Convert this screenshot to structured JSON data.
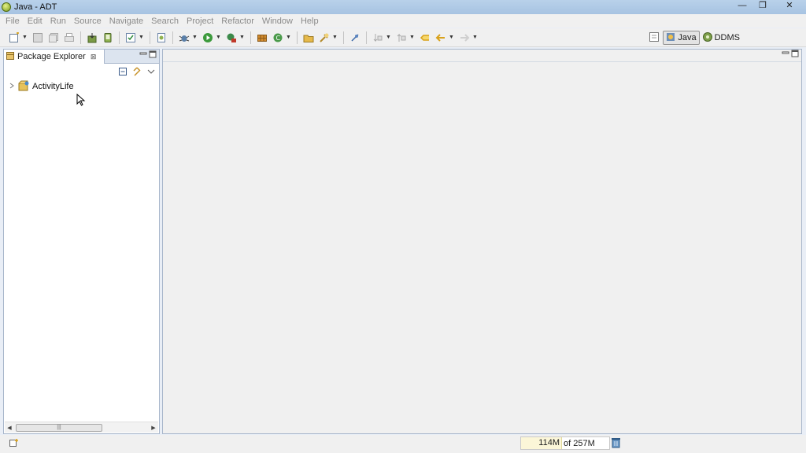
{
  "window": {
    "title": "Java - ADT",
    "controls": {
      "minimize": "—",
      "restore": "❐",
      "close": "✕"
    }
  },
  "menu": [
    "File",
    "Edit",
    "Run",
    "Source",
    "Navigate",
    "Search",
    "Project",
    "Refactor",
    "Window",
    "Help"
  ],
  "toolbar": {
    "icons": [
      "new-icon",
      "save-icon",
      "save-all-icon",
      "print-icon",
      "open-type-icon",
      "sdk-manager-icon",
      "checkbox-icon",
      "android-wizard-icon",
      "debug-icon",
      "run-icon",
      "external-tools-icon",
      "build-icon",
      "refresh-icon",
      "open-folder-icon",
      "search-flashlight-icon",
      "pin-icon",
      "next-annotation-icon",
      "prev-annotation-icon",
      "last-edit-icon",
      "back-icon",
      "forward-icon"
    ]
  },
  "perspectives": {
    "java_label": "Java",
    "ddms_label": "DDMS"
  },
  "package_explorer": {
    "tab_label": "Package Explorer",
    "tab_close": "⊠",
    "tree": [
      {
        "label": "ActivityLife",
        "icon": "android-project-icon"
      }
    ]
  },
  "status": {
    "heap_used": "114M",
    "heap_total": "of 257M"
  }
}
